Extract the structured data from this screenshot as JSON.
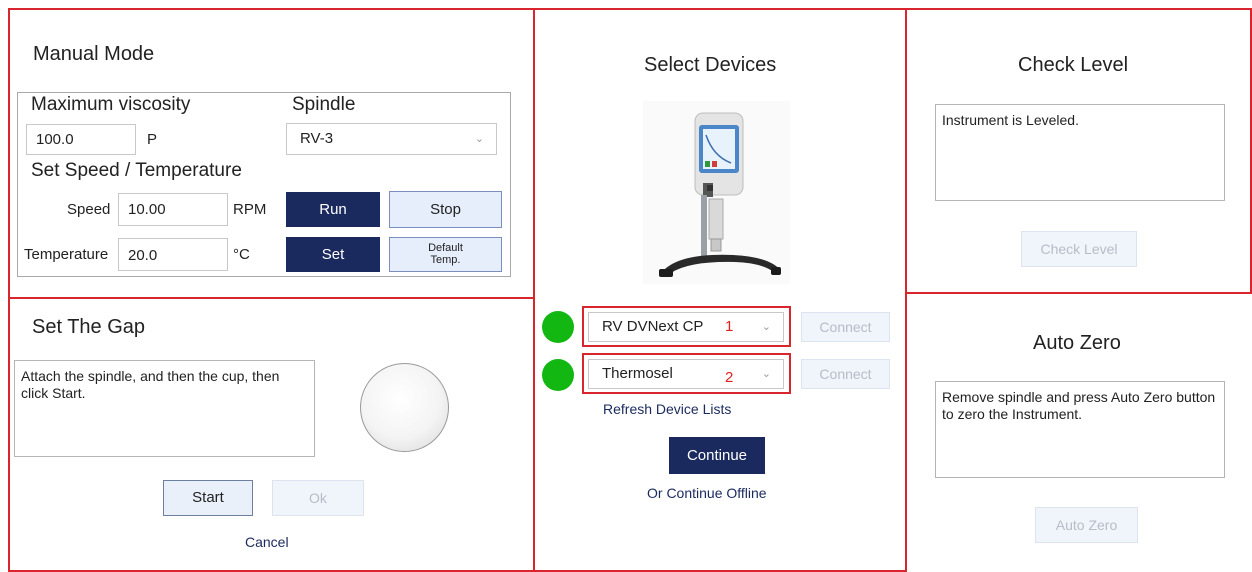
{
  "manual_mode": {
    "title": "Manual Mode",
    "max_viscosity_label": "Maximum viscosity",
    "viscosity_value": "100.0",
    "viscosity_unit": "P",
    "spindle_label": "Spindle",
    "spindle_value": "RV-3",
    "speed_temp_heading": "Set Speed / Temperature",
    "speed_label": "Speed",
    "speed_value": "10.00",
    "speed_unit": "RPM",
    "temp_label": "Temperature",
    "temp_value": "20.0",
    "temp_unit": "°C",
    "run_label": "Run",
    "stop_label": "Stop",
    "set_label": "Set",
    "default_temp_line1": "Default",
    "default_temp_line2": "Temp."
  },
  "gap": {
    "title": "Set The Gap",
    "instructions": "Attach the spindle, and then the cup, then click Start.",
    "start_label": "Start",
    "ok_label": "Ok",
    "cancel_label": "Cancel"
  },
  "devices": {
    "title": "Select Devices",
    "device1_value": "RV DVNext CP",
    "device1_number": "1",
    "device2_value": "Thermosel",
    "device2_number": "2",
    "connect_label": "Connect",
    "refresh_label": "Refresh Device Lists",
    "continue_label": "Continue",
    "offline_label": "Or Continue Offline"
  },
  "level": {
    "title": "Check Level",
    "message": "Instrument is Leveled.",
    "button_label": "Check Level"
  },
  "zero": {
    "title": "Auto Zero",
    "message": "Remove spindle and press Auto Zero button to zero the Instrument.",
    "button_label": "Auto Zero"
  },
  "colors": {
    "accent_dark": "#1b2a5e",
    "highlight_red": "#d9262c",
    "status_green": "#12b712"
  },
  "icons": {
    "chevron": "chevron-down-icon"
  }
}
